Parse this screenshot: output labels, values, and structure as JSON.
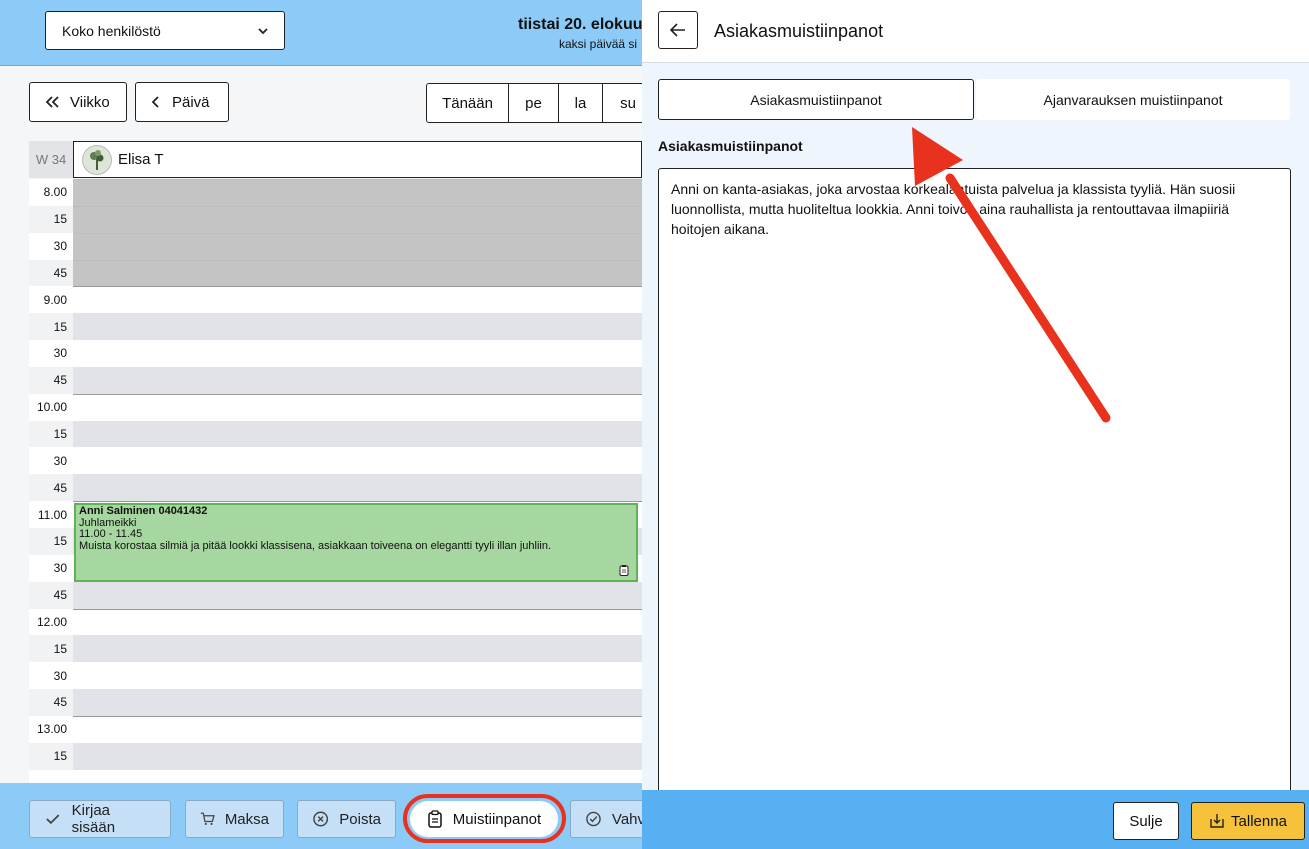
{
  "calendar": {
    "staff_select": "Koko henkilöstö",
    "date_title": "tiistai 20. elokuu",
    "date_sub": "kaksi päivää si",
    "nav": {
      "week": "Viikko",
      "day": "Päivä"
    },
    "days": [
      "Tänään",
      "pe",
      "la",
      "su"
    ],
    "week_label": "W 34",
    "staff_name": "Elisa T",
    "time_rows": [
      "8.00",
      "15",
      "30",
      "45",
      "9.00",
      "15",
      "30",
      "45",
      "10.00",
      "15",
      "30",
      "45",
      "11.00",
      "15",
      "30",
      "45",
      "12.00",
      "15",
      "30",
      "45",
      "13.00",
      "15",
      ""
    ],
    "appointment": {
      "name": "Anni Salminen  04041432",
      "service": "Juhlameikki",
      "time": "11.00 - 11.45",
      "note": "Muista korostaa silmiä ja pitää lookki klassisena, asiakkaan toiveena on elegantti tyyli illan juhliin."
    },
    "actions": {
      "checkin": "Kirjaa sisään",
      "pay": "Maksa",
      "delete": "Poista",
      "notes": "Muistiinpanot",
      "confirm": "Vahv"
    }
  },
  "panel": {
    "title": "Asiakasmuistiinpanot",
    "tabs": [
      "Asiakasmuistiinpanot",
      "Ajanvarauksen muistiinpanot"
    ],
    "notes_label": "Asiakasmuistiinpanot",
    "notes_text": "Anni on kanta-asiakas, joka arvostaa korkealaatuista palvelua ja klassista tyyliä. Hän suosii luonnollista, mutta huoliteltua lookkia. Anni toivoo aina rauhallista ja rentouttavaa ilmapiiriä hoitojen aikana.",
    "close": "Sulje",
    "save": "Tallenna"
  },
  "colors": {
    "topbar": "#8ccaf7",
    "appointment": "#a6d7a0",
    "annotation": "#e8321e",
    "save": "#f6c23c"
  }
}
